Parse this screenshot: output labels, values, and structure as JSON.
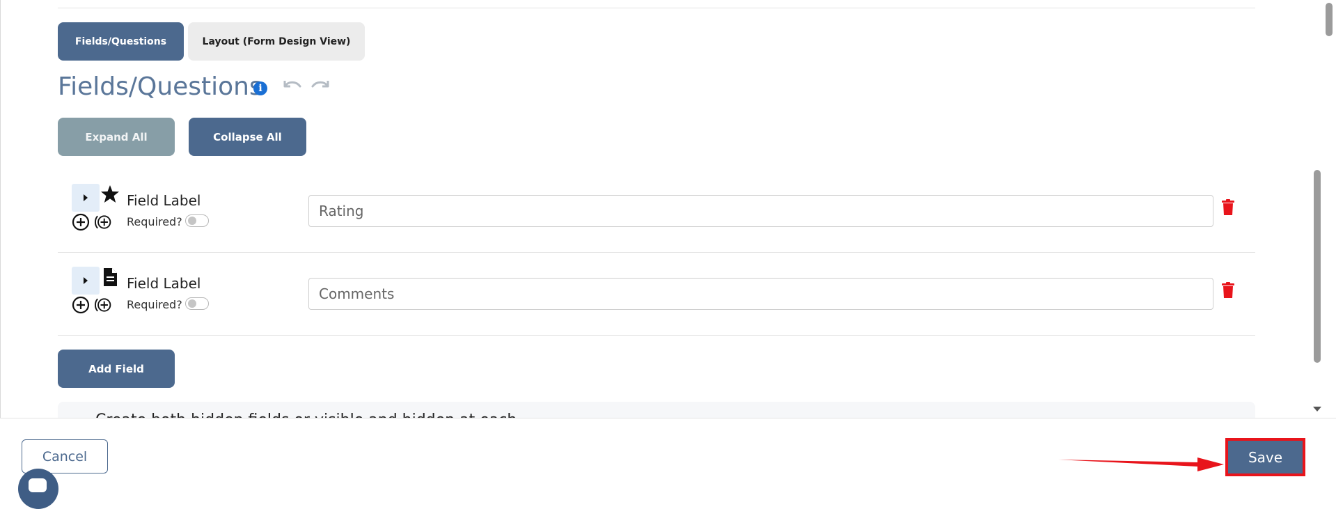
{
  "tabs": [
    {
      "label": "Fields/Questions",
      "active": true
    },
    {
      "label": "Layout (Form Design View)",
      "active": false
    }
  ],
  "section": {
    "title": "Fields/Questions",
    "info_icon": "i"
  },
  "buttons": {
    "expand_all": "Expand All",
    "collapse_all": "Collapse All",
    "add_field": "Add Field"
  },
  "fields": [
    {
      "label": "Field Label",
      "required_label": "Required?",
      "required": false,
      "value": "Rating",
      "type_icon": "star-icon"
    },
    {
      "label": "Field Label",
      "required_label": "Required?",
      "required": false,
      "value": "Comments",
      "type_icon": "document-icon"
    }
  ],
  "hint": {
    "text": "Create both hidden fields or visible and hidden at each"
  },
  "footer": {
    "cancel": "Cancel",
    "save": "Save"
  },
  "colors": {
    "primary": "#4c698e",
    "expand_button": "#879ea7",
    "title": "#5a7699",
    "info_icon": "#1a6fd4",
    "delete": "#e8141b",
    "annotation": "#e8141b"
  }
}
